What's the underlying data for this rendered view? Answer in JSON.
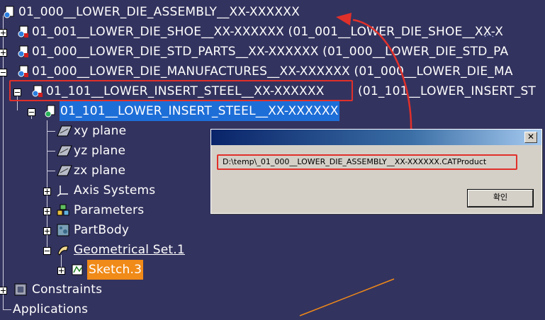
{
  "tree": {
    "root": "01_000__LOWER_DIE_ASSEMBLY__XX-XXXXXX",
    "nodes": [
      "01_001__LOWER_DIE_SHOE__XX-XXXXXX (01_001__LOWER_DIE_SHOE__XX-X",
      "01_000__LOWER_DIE_STD_PARTS__XX-XXXXXX (01_000__LOWER_DIE_STD_PA",
      "01_000__LOWER_DIE_MANUFACTURES__XX-XXXXXX (01_000__LOWER_DIE_MA",
      "01_101__LOWER_INSERT_STEEL__XX-XXXXXX",
      "(01_101__LOWER_INSERT_ST"
    ],
    "part": "01_101__LOWER_INSERT_STEEL__XX-XXXXXX",
    "children": {
      "xy_plane": "xy plane",
      "yz_plane": "yz plane",
      "zx_plane": "zx plane",
      "axis_systems": "Axis Systems",
      "parameters": "Parameters",
      "partbody": "PartBody",
      "geoset": "Geometrical Set.1",
      "sketch": "Sketch.3"
    },
    "constraints": "Constraints",
    "applications": "Applications"
  },
  "dialog": {
    "message": "D:\\temp\\_01_000__LOWER_DIE_ASSEMBLY__XX-XXXXXX.CATProduct",
    "close_label": "✕",
    "ok_label": "확인"
  },
  "colors": {
    "background": "#33335f",
    "selection": "#1e6ed8",
    "sketch_highlight": "#f08a18",
    "annotation": "#e0302a"
  }
}
